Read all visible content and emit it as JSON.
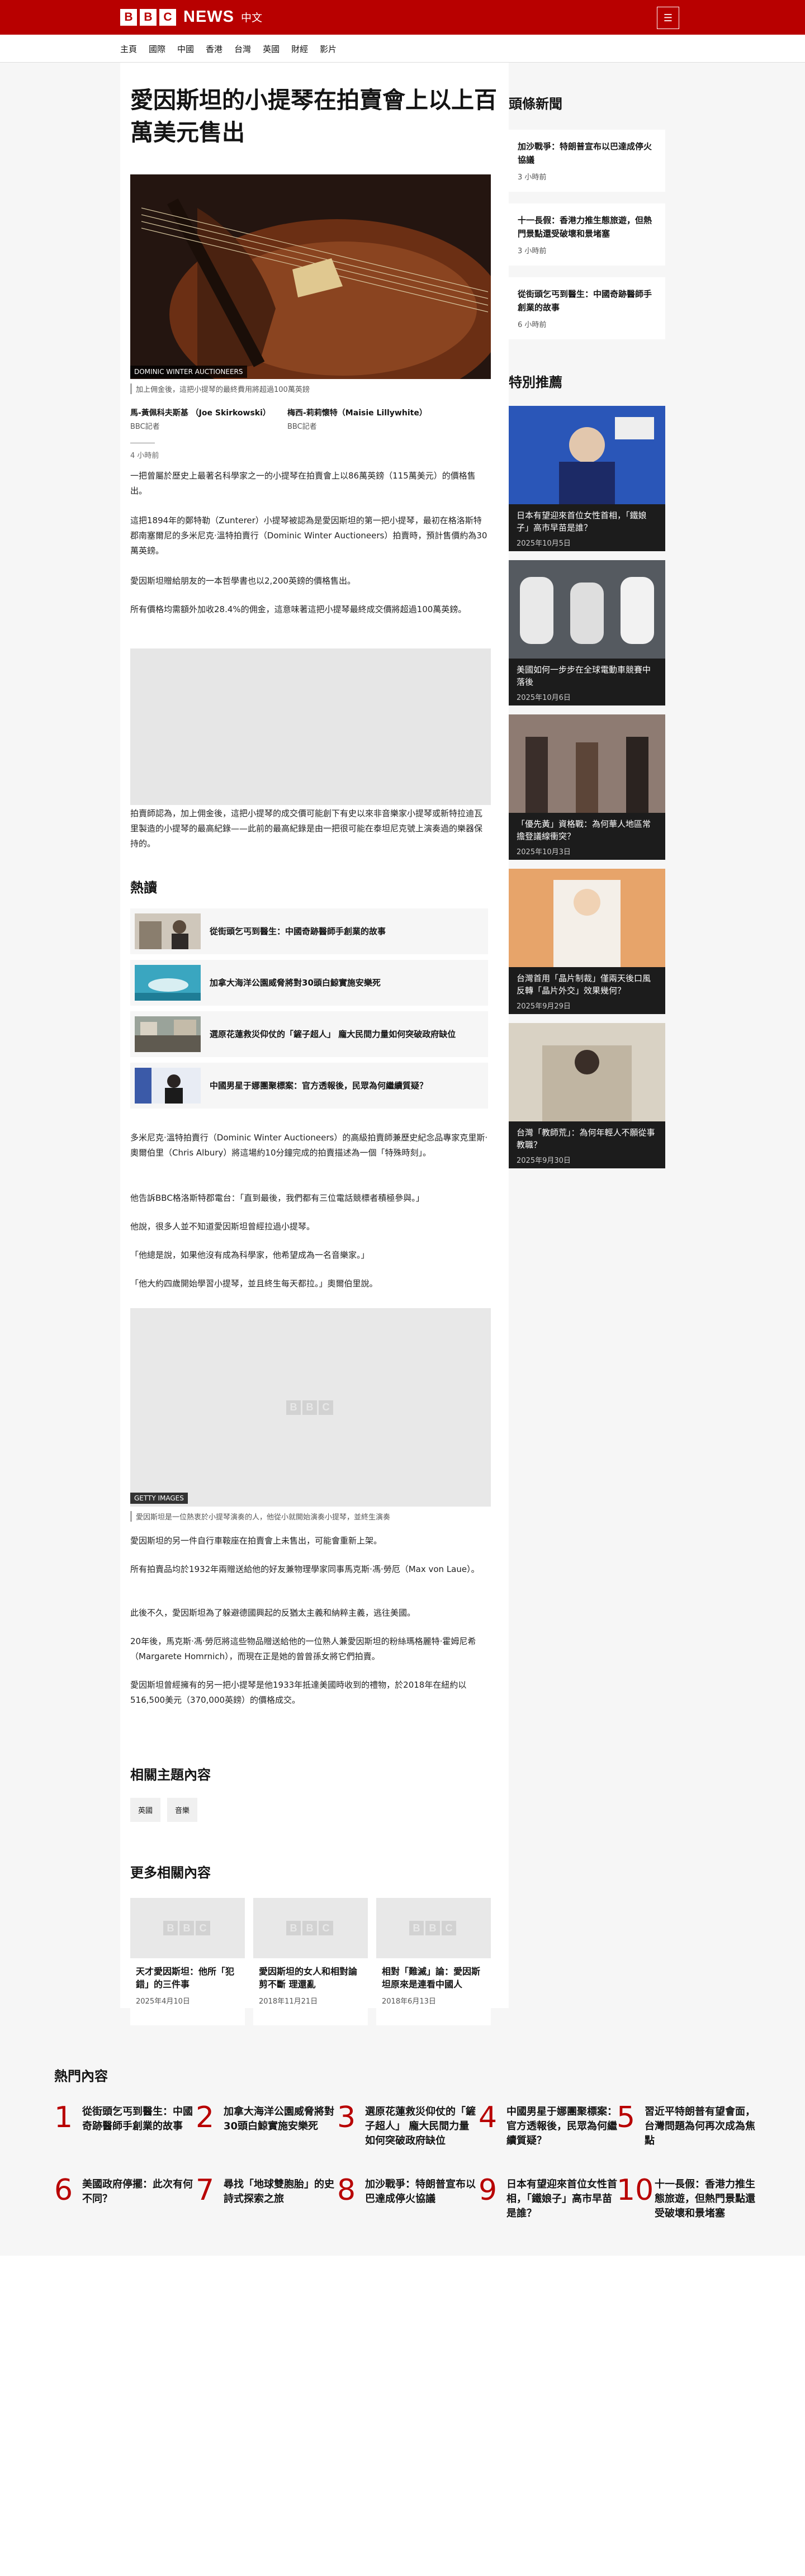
{
  "brand": {
    "letters": [
      "B",
      "B",
      "C"
    ],
    "news": "NEWS",
    "zh": "中文",
    "menu_icon": "menu-icon"
  },
  "nav": [
    "主頁",
    "國際",
    "中國",
    "香港",
    "台灣",
    "英國",
    "財經",
    "影片"
  ],
  "article": {
    "title": "愛因斯坦的小提琴在拍賣會上以上百萬美元售出",
    "hero_credit": "DOMINIC WINTER AUCTIONEERS",
    "hero_caption": "加上佣金後，這把小提琴的最終費用將超過100萬英鎊",
    "authors": [
      {
        "name": "馬-黃佩科夫斯基 （Joe Skirkowski）",
        "role": "BBC記者"
      },
      {
        "name": "梅西-莉莉懷特（Maisie Lillywhite）",
        "role": "BBC記者"
      }
    ],
    "time": "4 小時前",
    "p1": "一把曾屬於歷史上最著名科學家之一的小提琴在拍賣會上以86萬英鎊（115萬美元）的價格售出。",
    "p2": "這把1894年的鄭特勒（Zunterer）小提琴被認為是愛因斯坦的第一把小提琴，最初在格洛斯特郡南塞爾尼的多米尼克·溫特拍賣行（Dominic Winter Auctioneers）拍賣時，預計售價約為30萬英鎊。",
    "p3": "愛因斯坦贈給朋友的一本哲學書也以2,200英鎊的價格售出。",
    "p4": "所有價格均需額外加收28.4%的佣金，這意味著這把小提琴最終成交價將超過100萬英鎊。",
    "p5": "拍賣師認為，加上佣金後，這把小提琴的成交價可能創下有史以來非音樂家小提琴或新特拉迪瓦里製造的小提琴的最高紀錄——此前的最高紀錄是由一把很可能在泰坦尼克號上演奏過的樂器保持的。",
    "p6": "多米尼克·溫特拍賣行（Dominic Winter Auctioneers）的高級拍賣師兼歷史紀念品專家克里斯·奧爾伯里（Chris Albury）將這場約10分鐘完成的拍賣描述為一個「特殊時刻」。",
    "p7": "他告訴BBC格洛斯特郡電台：「直到最後，我們都有三位電話競標者積極參與。」",
    "p8": "他說，很多人並不知道愛因斯坦曾經拉過小提琴。",
    "p9": "「他總是說，如果他沒有成為科學家，他希望成為一名音樂家。」",
    "p10": "「他大約四歲開始學習小提琴，並且終生每天都拉。」奧爾伯里說。",
    "img2_credit": "GETTY IMAGES",
    "img2_caption": "愛因斯坦是一位熱衷於小提琴演奏的人，他從小就開始演奏小提琴，並終生演奏",
    "p11": "愛因斯坦的另一件自行車鞍座在拍賣會上未售出，可能會重新上架。",
    "p12": "所有拍賣品均於1932年兩贈送給他的好友兼物理學家同事馬克斯·馮·勞厄（Max von Laue）。",
    "p13": "此後不久，愛因斯坦為了躲避德國興起的反猶太主義和納粹主義，逃往美國。",
    "p14": "20年後，馬克斯·馮·勞厄將這些物品贈送給他的一位熟人兼愛因斯坦的粉絲瑪格麗特·霍姆尼希（Margarete Homrnich），而現在正是她的曾曾孫女將它們拍賣。",
    "p15": "愛因斯坦曾經擁有的另一把小提琴是他1933年抵達美國時收到的禮物，於2018年在紐約以516,500美元（370,000英鎊）的價格成交。"
  },
  "related": {
    "heading": "熱讀",
    "items": [
      "從街頭乞丐到醫生：中國奇跡醫師手創業的故事",
      "加拿大海洋公園威脅將對30頭白鯨實施安樂死",
      "選原花蓮救災仰仗的「鏟子超人」 龐大民間力量如何突破政府缺位",
      "中國男星于娜團聚標案：官方透報後，民眾為何繼續質疑？"
    ]
  },
  "topics": {
    "heading": "相關主題內容",
    "tags": [
      "英國",
      "音樂"
    ]
  },
  "more": {
    "heading": "更多相關內容",
    "cards": [
      {
        "title": "天才愛因斯坦：他所「犯錯」的三件事",
        "date": "2025年4月10日"
      },
      {
        "title": "愛因斯坦的女人和相對論 剪不斷 理還亂",
        "date": "2018年11月21日"
      },
      {
        "title": "相對「難滅」論：愛因斯坦原來是連看中國人",
        "date": "2018年6月13日"
      }
    ]
  },
  "sidebar": {
    "top_heading": "頭條新聞",
    "top": [
      {
        "title": "加沙戰爭：特朗普宣布以巴達成停火協議",
        "time": "3 小時前"
      },
      {
        "title": "十一長假：香港力推生態旅遊，但熱門景點還受破壞和景堵塞",
        "time": "3 小時前"
      },
      {
        "title": "從街頭乞丐到醫生：中國奇跡醫師手創業的故事",
        "time": "6 小時前"
      }
    ],
    "feat_heading": "特別推薦",
    "feat": [
      {
        "title": "日本有望迎來首位女性首相，「鐵娘子」高市早苗是誰？",
        "date": "2025年10月5日"
      },
      {
        "title": "美國如何一步步在全球電動車競賽中落後",
        "date": "2025年10月6日"
      },
      {
        "title": "「優先黃」資格戰：為何華人地區常擔登議線衝突？",
        "date": "2025年10月3日"
      },
      {
        "title": "台灣首用「晶片制裁」僅兩天後口風反轉「晶片外交」效果幾何？",
        "date": "2025年9月29日"
      },
      {
        "title": "台灣「教師荒」：為何年輕人不願從事教職？",
        "date": "2025年9月30日"
      }
    ]
  },
  "hot": {
    "heading": "熱門內容",
    "items": [
      {
        "n": "1",
        "t": "從街頭乞丐到醫生：中國奇跡醫師手創業的故事"
      },
      {
        "n": "2",
        "t": "加拿大海洋公園威脅將對30頭白鯨實施安樂死"
      },
      {
        "n": "3",
        "t": "選原花蓮救災仰仗的「鏟子超人」 龐大民間力量如何突破政府缺位"
      },
      {
        "n": "4",
        "t": "中國男星于娜團聚標案：官方透報後，民眾為何繼續質疑？"
      },
      {
        "n": "5",
        "t": "習近平特朗普有望會面，台灣問題為何再次成為焦點"
      },
      {
        "n": "6",
        "t": "美國政府停擺：此次有何不同？"
      },
      {
        "n": "7",
        "t": "尋找「地球雙胞胎」的史詩式探索之旅"
      },
      {
        "n": "8",
        "t": "加沙戰爭：特朗普宣布以巴達成停火協議"
      },
      {
        "n": "9",
        "t": "日本有望迎來首位女性首相，「鐵娘子」高市早苗是誰？"
      },
      {
        "n": "10",
        "t": "十一長假：香港力推生態旅遊，但熱門景點還受破壞和景堵塞"
      }
    ]
  }
}
